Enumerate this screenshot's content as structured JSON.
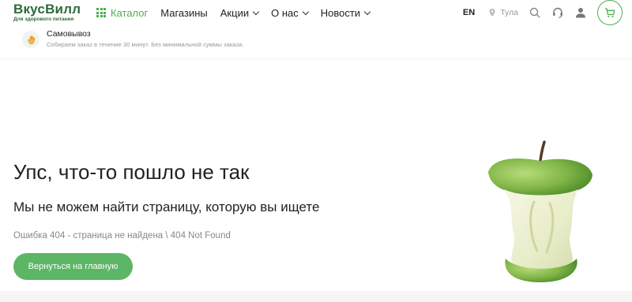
{
  "logo": {
    "name": "ВкусВилл",
    "tagline": "Для здорового питания"
  },
  "nav": {
    "catalog": "Каталог",
    "stores": "Магазины",
    "promos": "Акции",
    "about": "О нас",
    "news": "Новости"
  },
  "header_right": {
    "lang": "EN",
    "city": "Тула"
  },
  "pickup": {
    "title": "Самовывоз",
    "description": "Собираем заказ в течение 30 минут. Без минимальной суммы заказа."
  },
  "main": {
    "title": "Упс, что-то пошло не так",
    "subtitle": "Мы не можем найти страницу, которую вы ищете",
    "error": "Ошибка 404 - страница не найдена \\ 404 Not Found",
    "button": "Вернуться на главную"
  },
  "colors": {
    "brand_green": "#2e6b3a",
    "accent_green": "#4caf50",
    "button_green": "#5cb665"
  },
  "icons": [
    "grid-icon",
    "chevron-down-icon",
    "location-pin-icon",
    "search-icon",
    "support-icon",
    "user-icon",
    "cart-icon",
    "hand-icon"
  ]
}
